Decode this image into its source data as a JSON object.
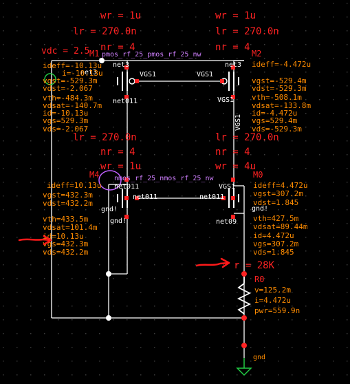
{
  "colors": {
    "background": "#000000",
    "wire": "#ffffff",
    "param": "#ff2222",
    "op": "#ff8c00",
    "net": "#ffffff",
    "title": "#d080ff",
    "annotation": "#ff1a1a",
    "dot": "#3a3a3a"
  },
  "source": {
    "label": "vdc = 2.5"
  },
  "M1": {
    "name": "M1",
    "model": "pmos_rf_25_pmos_rf_25_nw",
    "params": [
      "wr = 1u",
      "lr = 270.0n",
      "nr = 4"
    ],
    "pins": {
      "gate": "VGS1",
      "drain": "net3",
      "source": "net3",
      "body": "net011"
    },
    "op": [
      "ideff=-10.13u",
      "i=-10.13u",
      "vgst=-529.3m",
      "vdst=-2.067",
      "vth=-484.3m",
      "vdsat=-140.7m",
      "id=-10.13u",
      "vgs=529.3m",
      "vds=-2.067"
    ]
  },
  "M2": {
    "name": "M2",
    "params": [
      "wr = 1u",
      "lr = 270.0n",
      "nr = 4"
    ],
    "pins": {
      "gate": "VGS1",
      "drain": "net3",
      "source": "VGS1",
      "body": "VGS1"
    },
    "op": [
      "ideff=-4.472u",
      "vgst=-529.4m",
      "vdst=-529.3m",
      "vth=-508.1m",
      "vdsat=-133.8m",
      "id=-4.472u",
      "vgs=529.4m",
      "vds=-529.3m"
    ]
  },
  "M4": {
    "name": "M4",
    "model": "nmos_rf_25_nmos_rf_25_nw",
    "params": [
      "lr = 270.0n",
      "nr = 4",
      "wr = 1u"
    ],
    "pins": {
      "gate": "net011",
      "drain": "net011",
      "source": "gnd!",
      "body": "gnd!"
    },
    "op": [
      "ideff=10.13u",
      "vgst=432.3m",
      "vdst=432.2m",
      "vth=433.5m",
      "vdsat=101.4m",
      "id=10.13u",
      "vgs=432.3m",
      "vds=432.2m"
    ]
  },
  "M0": {
    "name": "M0",
    "params": [
      "lr = 270.0n",
      "nr = 4",
      "wr = 4u"
    ],
    "pins": {
      "gate": "VGS1",
      "drain": "net011",
      "source": "net09",
      "body": "gnd!"
    },
    "op": [
      "ideff=4.472u",
      "vgst=307.2m",
      "vdst=1.845",
      "vth=427.5m",
      "vdsat=89.44m",
      "id=4.472u",
      "vgs=307.2m",
      "vds=1.845"
    ]
  },
  "R0": {
    "name": "R0",
    "param": "r = 28K",
    "op": [
      "v=125.2m",
      "i=4.472u",
      "pwr=559.9n"
    ]
  },
  "gnd": {
    "label": "gnd"
  }
}
